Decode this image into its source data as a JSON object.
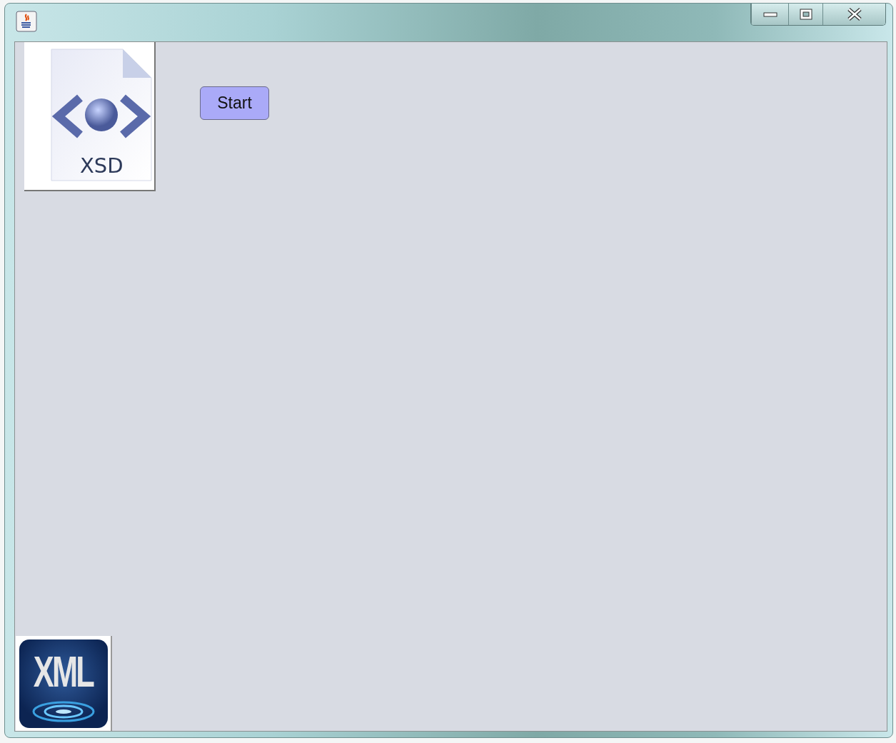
{
  "window": {
    "controls": [
      {
        "kind": "minimize"
      },
      {
        "kind": "maximize"
      },
      {
        "kind": "close"
      }
    ]
  },
  "xsd_icon": {
    "label": "XSD"
  },
  "start_button": {
    "label": "Start"
  },
  "xml_icon": {
    "label": "XML"
  }
}
